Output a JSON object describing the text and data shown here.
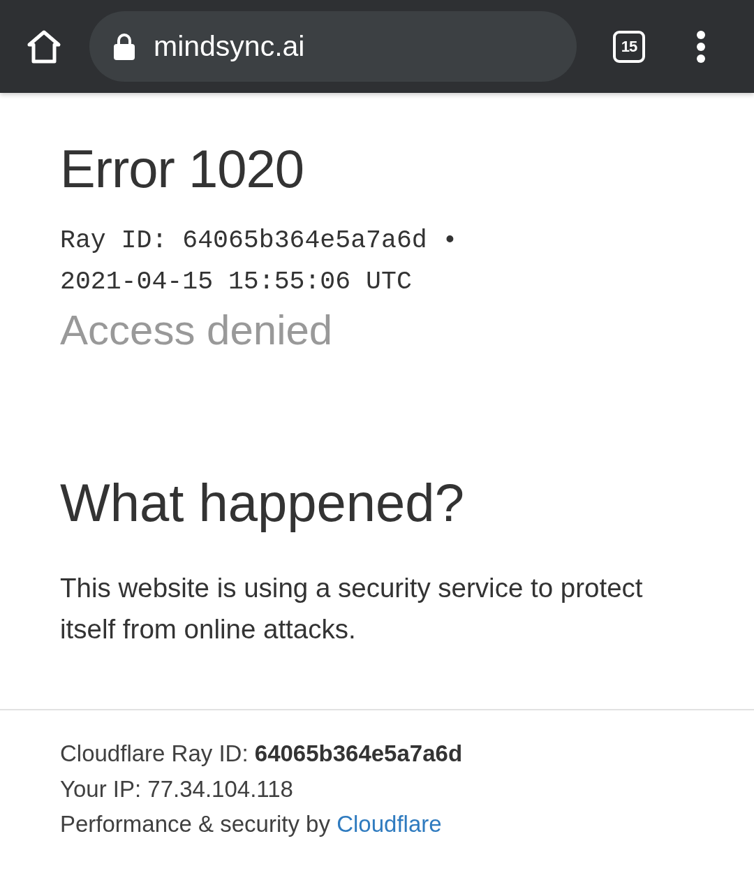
{
  "toolbar": {
    "url": "mindsync.ai",
    "tab_count": "15"
  },
  "error": {
    "title": "Error 1020",
    "ray_line": "Ray ID: 64065b364e5a7a6d • 2021-04-15 15:55:06 UTC",
    "subtitle": "Access denied"
  },
  "section": {
    "heading": "What happened?",
    "body": "This website is using a security service to protect itself from online attacks."
  },
  "footer": {
    "lines": [
      "Cloudflare Ray ID: **64065b364e5a7a6d**",
      "Your IP: 77.34.104.118"
    ],
    "credit": {
      "text": "Performance & security by",
      "link": "Cloudflare"
    }
  }
}
